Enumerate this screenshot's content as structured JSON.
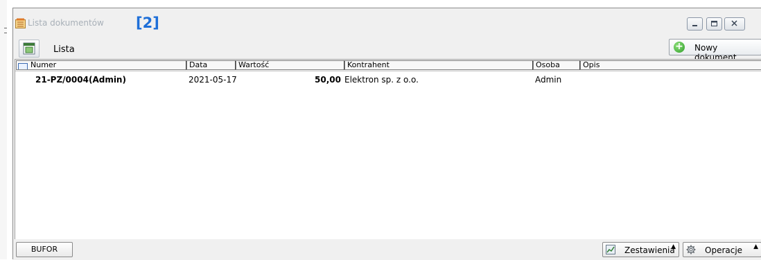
{
  "window": {
    "title": "Lista dokumentów",
    "badge": "[2]"
  },
  "toolbar": {
    "view_label": "Lista",
    "new_document_label": "Nowy dokument"
  },
  "table": {
    "columns": [
      "Numer",
      "Data",
      "Wartość",
      "Kontrahent",
      "Osoba",
      "Opis"
    ],
    "rows": [
      {
        "numer": "21-PZ/0004(Admin)",
        "data": "2021-05-17",
        "wartosc": "50,00",
        "kontrahent": "Elektron sp. z o.o.",
        "osoba": "Admin",
        "opis": ""
      }
    ]
  },
  "statusbar": {
    "bufor_label": "BUFOR",
    "zestawienia_label": "Zestawienia",
    "operacje_label": "Operacje"
  },
  "icons": {
    "window_icon": "document-list-icon",
    "view_icon": "list-view-icon",
    "new_document_icon": "green-plus-icon",
    "zestawienia_icon": "chart-icon",
    "operacje_icon": "gear-icon"
  }
}
